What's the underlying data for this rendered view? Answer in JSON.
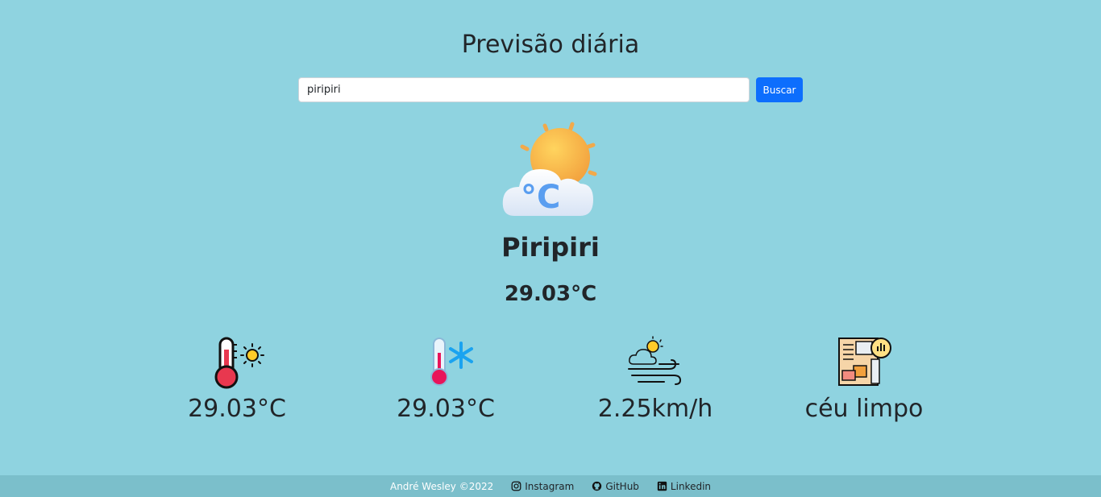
{
  "header": {
    "title": "Previsão diária"
  },
  "search": {
    "value": "piripiri",
    "button_label": "Buscar"
  },
  "weather": {
    "icon": "sun-cloud-celsius-icon",
    "city": "Piripiri",
    "temperature": "29.03°C"
  },
  "stats": [
    {
      "icon": "thermometer-sun-icon",
      "value": "29.03°C"
    },
    {
      "icon": "thermometer-snowflake-icon",
      "value": "29.03°C"
    },
    {
      "icon": "wind-cloud-icon",
      "value": "2.25km/h"
    },
    {
      "icon": "weather-report-icon",
      "value": "céu limpo"
    }
  ],
  "footer": {
    "copyright": "André Wesley ©2022",
    "links": [
      {
        "icon": "instagram-icon",
        "label": "Instagram"
      },
      {
        "icon": "github-icon",
        "label": "GitHub"
      },
      {
        "icon": "linkedin-icon",
        "label": "Linkedin"
      }
    ]
  },
  "colors": {
    "background": "#8fd3e0",
    "footer": "#7bbfcb",
    "button": "#0d6efd"
  }
}
